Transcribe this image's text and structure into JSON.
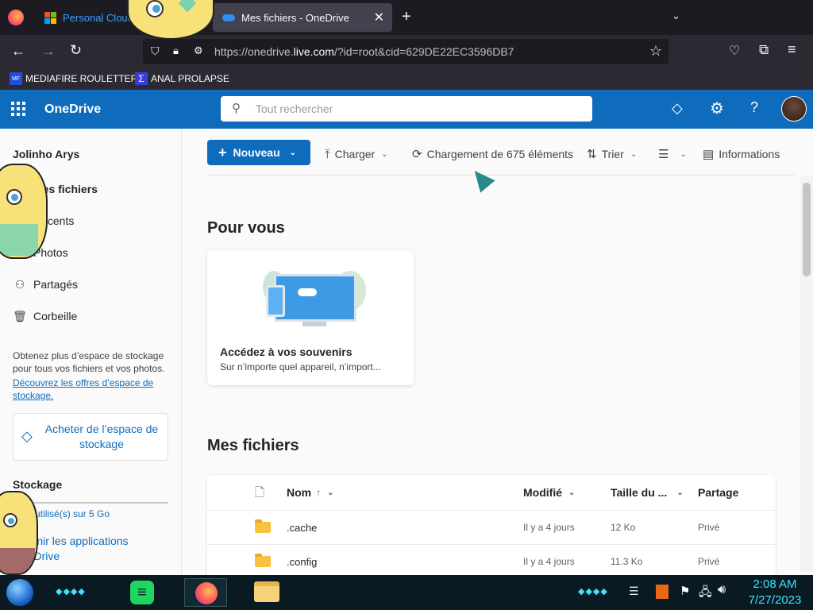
{
  "browser": {
    "tabs": [
      {
        "label": "Personal Cloud",
        "icon": "microsoft-logo"
      },
      {
        "label": "Mes fichiers - OneDrive",
        "icon": "onedrive-cloud"
      }
    ],
    "url_prefix": "https://onedrive.",
    "url_domain": "live.com",
    "url_rest": "/?id=root&cid=629DE22EC3596DB7",
    "bookmarks": [
      {
        "label": "MEDIAFIRE ROULETTER"
      },
      {
        "label": "ANAL PROLAPSE"
      }
    ]
  },
  "header": {
    "app_name": "OneDrive",
    "search_placeholder": "Tout rechercher"
  },
  "sidebar": {
    "user": "Jolinho Arys",
    "items": [
      {
        "label": "Mes fichiers",
        "icon": "folder-icon"
      },
      {
        "label": "Récents",
        "icon": "clock-icon"
      },
      {
        "label": "Photos",
        "icon": "image-icon"
      },
      {
        "label": "Partagés",
        "icon": "people-icon"
      },
      {
        "label": "Corbeille",
        "icon": "trash-icon"
      }
    ],
    "promo_text": "Obtenez plus d’espace de stockage pour tous vos fichiers et vos photos.",
    "promo_link": "Découvrez les offres d’espace de stockage.",
    "buy_button": "Acheter de l’espace de stockage",
    "storage_title": "Stockage",
    "storage_usage": "0 Ko utilisé(s) sur 5 Go",
    "storage_fill": 0.01,
    "get_apps": "Obtenir les applications OneDrive"
  },
  "toolbar": {
    "new": "Nouveau",
    "upload": "Charger",
    "loading": "Chargement de 675 éléments",
    "sort": "Trier",
    "info": "Informations"
  },
  "for_you": {
    "title": "Pour vous",
    "card_title": "Accédez à vos souvenirs",
    "card_subtitle": "Sur n’importe quel appareil, n’import..."
  },
  "files": {
    "title": "Mes fichiers",
    "columns": [
      "Nom",
      "Modifié",
      "Taille du ...",
      "Partage"
    ],
    "rows": [
      {
        "name": ".cache",
        "modified": "Il y a 4 jours",
        "size": "12 Ko",
        "sharing": "Privé"
      },
      {
        "name": ".config",
        "modified": "Il y a 4 jours",
        "size": "11.3 Ko",
        "sharing": "Privé"
      }
    ]
  },
  "taskbar": {
    "time": "2:08 AM",
    "date": "7/27/2023"
  },
  "colors": {
    "brand": "#0f6cbd",
    "link": "#0f6cbd"
  }
}
